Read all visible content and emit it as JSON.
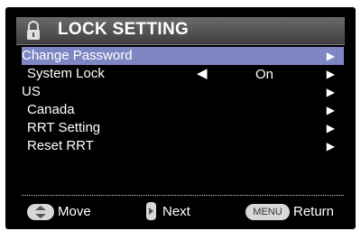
{
  "header": {
    "title": "LOCK SETTING",
    "icon": "lock-icon"
  },
  "menu": {
    "items": [
      {
        "label": "Change Password",
        "selected": true,
        "arrow": "▶"
      },
      {
        "label": "System Lock",
        "left_arrow": "◀",
        "value": "On",
        "arrow": "▶"
      },
      {
        "label": "US",
        "arrow": "▶"
      },
      {
        "label": "Canada",
        "arrow": "▶"
      },
      {
        "label": "RRT Setting",
        "arrow": "▶"
      },
      {
        "label": "Reset RRT",
        "arrow": "▶"
      }
    ]
  },
  "footer": {
    "move_label": "Move",
    "next_label": "Next",
    "menu_key_label": "MENU",
    "return_label": "Return"
  },
  "colors": {
    "selected_row": "#7f86c4",
    "header_top": "#6b6b6b",
    "background": "#000000"
  }
}
